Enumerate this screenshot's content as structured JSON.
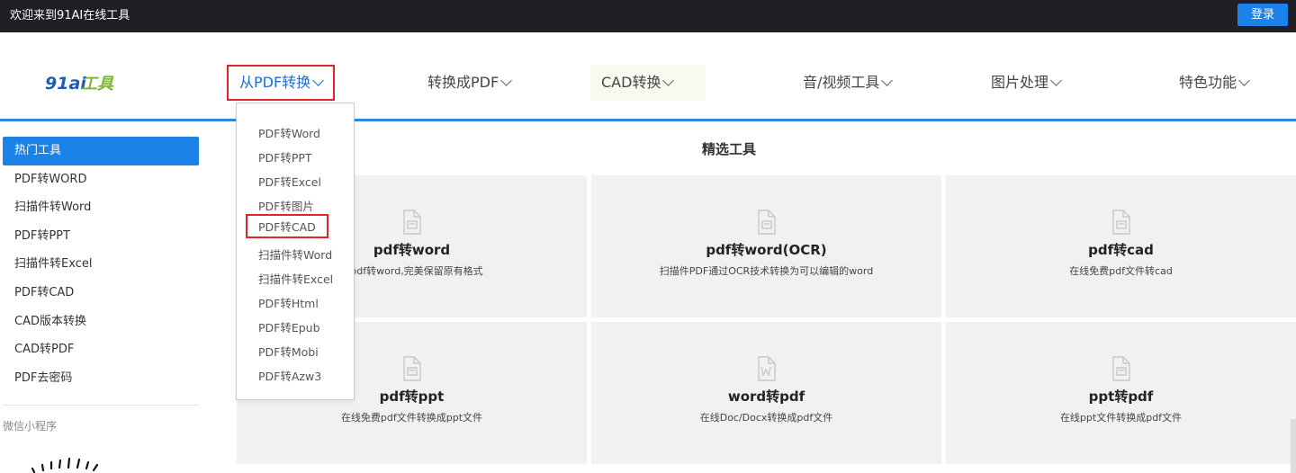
{
  "topbar": {
    "welcome": "欢迎来到91AI在线工具",
    "login_label": "登录"
  },
  "brand": {
    "logo_text": "91ai工具",
    "accent_blue": "#1a82e8",
    "accent_red": "#e0242a",
    "logo_green": "#7cb82f"
  },
  "nav": {
    "items": [
      {
        "label": "从PDF转换",
        "active": true
      },
      {
        "label": "转换成PDF",
        "active": false
      },
      {
        "label": "CAD转换",
        "active": false
      },
      {
        "label": "音/视频工具",
        "active": false
      },
      {
        "label": "图片处理",
        "active": false
      },
      {
        "label": "特色功能",
        "active": false
      }
    ]
  },
  "dropdown": {
    "items": [
      "PDF转Word",
      "PDF转PPT",
      "PDF转Excel",
      "PDF转图片",
      "PDF转CAD",
      "扫描件转Word",
      "扫描件转Excel",
      "PDF转Html",
      "PDF转Epub",
      "PDF转Mobi",
      "PDF转Azw3"
    ],
    "highlighted": "PDF转CAD"
  },
  "sidebar": {
    "items": [
      "热门工具",
      "PDF转WORD",
      "扫描件转Word",
      "PDF转PPT",
      "扫描件转Excel",
      "PDF转CAD",
      "CAD版本转换",
      "CAD转PDF",
      "PDF去密码"
    ],
    "active": "热门工具",
    "mini_program_label": "微信小程序"
  },
  "main": {
    "section_title": "精选工具",
    "cards": [
      {
        "title": "pdf转word",
        "desc": "费pdf转word,完美保留原有格式",
        "icon": "pdf-doc-icon"
      },
      {
        "title": "pdf转word(OCR)",
        "desc": "扫描件PDF通过OCR技术转换为可以编辑的word",
        "icon": "pdf-doc-icon"
      },
      {
        "title": "pdf转cad",
        "desc": "在线免费pdf文件转cad",
        "icon": "pdf-doc-icon"
      },
      {
        "title": "pdf转ppt",
        "desc": "在线免费pdf文件转换成ppt文件",
        "icon": "pdf-doc-icon"
      },
      {
        "title": "word转pdf",
        "desc": "在线Doc/Docx转换成pdf文件",
        "icon": "word-doc-icon"
      },
      {
        "title": "ppt转pdf",
        "desc": "在线ppt文件转换成pdf文件",
        "icon": "pdf-doc-icon"
      }
    ]
  }
}
